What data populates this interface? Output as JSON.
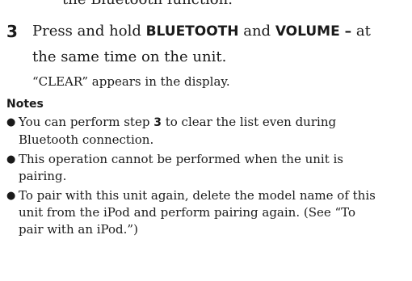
{
  "fragment": "the Bluetooth function.",
  "step": {
    "number": "3",
    "pre": "Press and hold ",
    "key1": "BLUETOOTH",
    "and": " and ",
    "key2": "VOLUME –",
    "post": " at",
    "line2": "the same time on the unit.",
    "result": "“CLEAR” appears in the display."
  },
  "notes": {
    "heading": "Notes",
    "n1": {
      "pre": "You can perform step ",
      "bold": "3",
      "post": " to clear the list even during\nBluetooth connection."
    },
    "n2": "This operation cannot be performed when the unit is\npairing.",
    "n3": "To pair with this unit again, delete the model name of this\nunit from the iPod and perform pairing again. (See “To\npair with an iPod.”)"
  }
}
